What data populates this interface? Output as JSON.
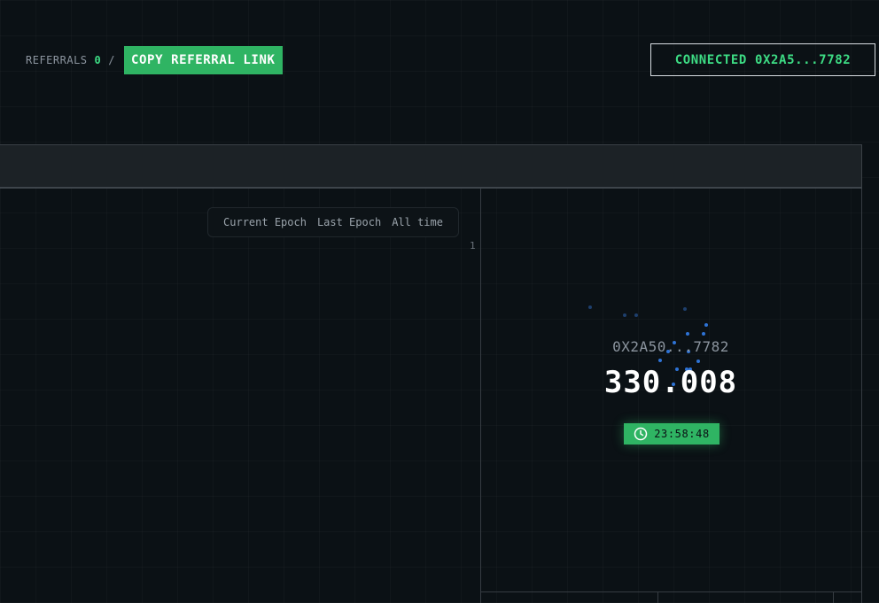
{
  "referrals": {
    "label": "REFERRALS",
    "count": "0",
    "separator": "/",
    "copy_button": "COPY REFERRAL LINK"
  },
  "wallet": {
    "status": "CONNECTED",
    "address": "0X2A5...7782"
  },
  "epoch_tabs": [
    "Current Epoch",
    "Last Epoch",
    "All time"
  ],
  "chart_axis": {
    "tick": "1"
  },
  "profile": {
    "address": "0X2A50...7782",
    "score": "330.008",
    "timer": "23:58:48",
    "timer_icon": "clock-icon"
  },
  "colors": {
    "accent_green": "#2fb463",
    "text_green": "#3ddc84",
    "background": "#0b1115",
    "dot_blue": "#2e73d6"
  }
}
